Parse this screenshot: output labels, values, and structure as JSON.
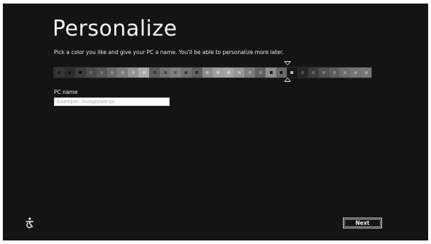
{
  "page": {
    "title": "Personalize",
    "subtitle": "Pick a color you like and give your PC a name. You'll be able to personalize more later."
  },
  "color_picker": {
    "swatches": [
      {
        "bg": "#343434",
        "dot": "#1e1e1e"
      },
      {
        "bg": "#2b2b2b",
        "dot": "#151515"
      },
      {
        "bg": "#3d3d3d",
        "dot": "#0c0c0c"
      },
      {
        "bg": "#4a4a4a",
        "dot": "#666666"
      },
      {
        "bg": "#575757",
        "dot": "#737373"
      },
      {
        "bg": "#6a6a6a",
        "dot": "#888888"
      },
      {
        "bg": "#7d7d7d",
        "dot": "#9a9a9a"
      },
      {
        "bg": "#949494",
        "dot": "#b3b3b3"
      },
      {
        "bg": "#ababab",
        "dot": "#c8c8c8"
      },
      {
        "bg": "#5c5c5c",
        "dot": "#3a3a3a"
      },
      {
        "bg": "#727272",
        "dot": "#4a4a4a"
      },
      {
        "bg": "#808080",
        "dot": "#5a5a5a"
      },
      {
        "bg": "#6f6f6f",
        "dot": "#3e3e3e"
      },
      {
        "bg": "#5e5e5e",
        "dot": "#2d2d2d"
      },
      {
        "bg": "#8c8c8c",
        "dot": "#b6b6b6"
      },
      {
        "bg": "#9f9f9f",
        "dot": "#c4c4c4"
      },
      {
        "bg": "#a5a5a5",
        "dot": "#cfcfcf"
      },
      {
        "bg": "#959595",
        "dot": "#bdbdbd"
      },
      {
        "bg": "#7b7b7b",
        "dot": "#a1a1a1"
      },
      {
        "bg": "#616161",
        "dot": "#888888"
      },
      {
        "bg": "#8f8f8f",
        "dot": "#1c1c1c"
      },
      {
        "bg": "#6a6a6a",
        "dot": "#1a1a1a"
      },
      {
        "bg": "#181818",
        "dot": "#b8b8b8"
      },
      {
        "bg": "#262626",
        "dot": "#4d4d4d"
      },
      {
        "bg": "#3b3b3b",
        "dot": "#616161"
      },
      {
        "bg": "#505050",
        "dot": "#777777"
      },
      {
        "bg": "#5d5d5d",
        "dot": "#838383"
      },
      {
        "bg": "#6c6c6c",
        "dot": "#939393"
      },
      {
        "bg": "#737373",
        "dot": "#9c9c9c"
      },
      {
        "bg": "#777777",
        "dot": "#a2a2a2"
      }
    ],
    "selected_index": 22
  },
  "pc_name": {
    "label": "PC name",
    "value": "",
    "placeholder": "Example: livingroom-pc"
  },
  "footer": {
    "ease_of_access_icon": "ease-of-access-icon",
    "next_label": "Next"
  }
}
